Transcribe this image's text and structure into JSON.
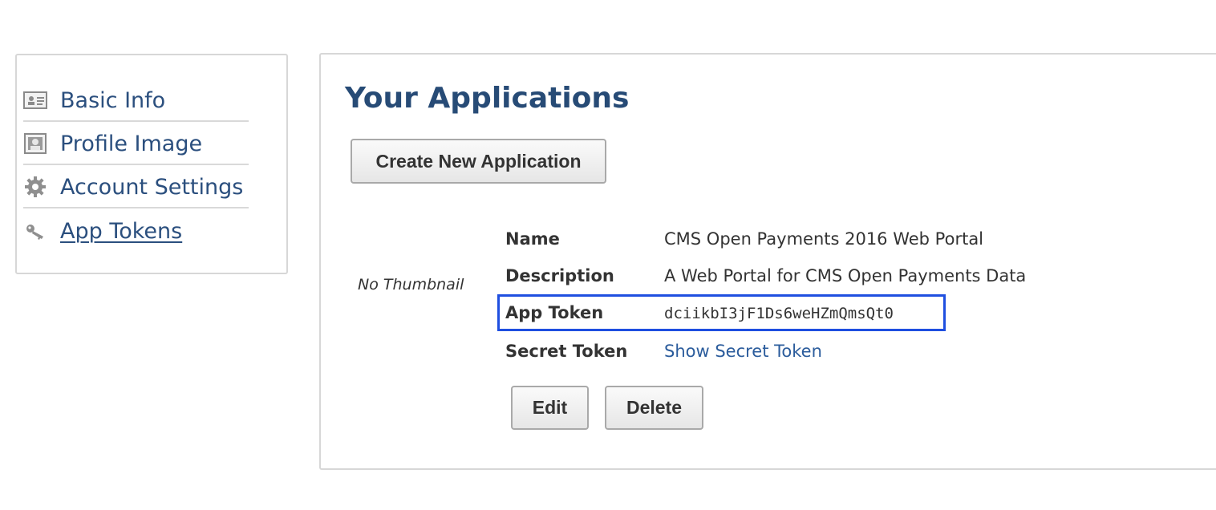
{
  "sidebar": {
    "items": [
      {
        "label": "Basic Info",
        "icon": "id-card-icon"
      },
      {
        "label": "Profile Image",
        "icon": "portrait-icon"
      },
      {
        "label": "Account Settings",
        "icon": "gear-icon"
      },
      {
        "label": "App Tokens",
        "icon": "key-icon",
        "active": true
      }
    ]
  },
  "main": {
    "title": "Your Applications",
    "create_button": "Create New Application",
    "application": {
      "thumbnail_text": "No Thumbnail",
      "name_label": "Name",
      "name_value": "CMS Open Payments 2016 Web Portal",
      "description_label": "Description",
      "description_value": "A Web Portal for CMS Open Payments Data",
      "app_token_label": "App Token",
      "app_token_value": "dciikbI3jF1Ds6weHZmQmsQt0",
      "secret_token_label": "Secret Token",
      "secret_token_link": "Show Secret Token",
      "edit_button": "Edit",
      "delete_button": "Delete"
    }
  },
  "colors": {
    "accent": "#274b76",
    "link": "#2b5c9c",
    "highlight_border": "#1f4fe0"
  }
}
